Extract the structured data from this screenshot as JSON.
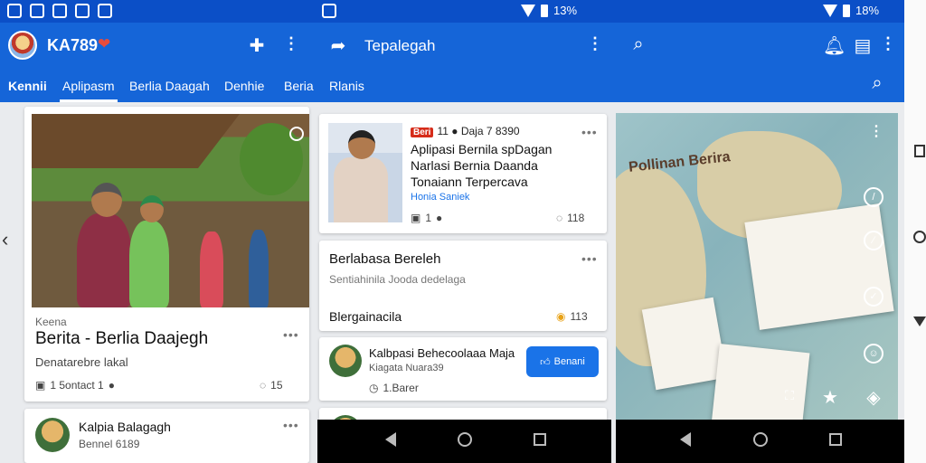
{
  "status_bar": {
    "left_time": "",
    "mid_icon": "ᵒ",
    "mid_text": "",
    "right1_text": "13%",
    "right2_text": "18%"
  },
  "app_bar": {
    "title": "KA789",
    "heart": "❤",
    "second_title": "Tepalegah",
    "logo": "app-logo"
  },
  "tabs": [
    {
      "label": "Kennii"
    },
    {
      "label": "Aplipasm"
    },
    {
      "label": "Berlia Daagah"
    },
    {
      "label": "Denhie"
    },
    {
      "label": "Beria"
    },
    {
      "label": "Rlanis"
    }
  ],
  "feed_card_1": {
    "label": "Keena",
    "title": "Berita - Berlia Daajegh",
    "subtitle": "Denatarebre lakal",
    "meta_left": "1 5ontact 1",
    "meta_right": "15"
  },
  "feed_card_2": {
    "title": "Kalpia Balagagh",
    "subtitle": "Bennel 6189"
  },
  "news_card": {
    "badge": "Beri",
    "header_text": "11 ● Daja 7 8390",
    "line1": "Aplipasi Bernila spDagan",
    "line2": "Narlasi Bernia Daanda",
    "line3": "Tonaiann Terpercava",
    "source": "Honia Saniek",
    "meta_left": "1",
    "meta_right": "118"
  },
  "text_card": {
    "title": "Berlabasa Bereleh",
    "subtitle": "Sentiahinila Jooda dedelaga",
    "footer": "Blergainacila",
    "meta_right": "113"
  },
  "follow_card": {
    "title": "Kalbpasi Behecoolaaa Maja",
    "subtitle": "Kiagata Nuara39",
    "meta": "1.Barer",
    "button_label": "Benani"
  },
  "bottom_peek": {
    "text": "..."
  },
  "map_panel": {
    "title": "Pollinan Berira"
  },
  "icons": {
    "search": "search-icon",
    "share": "share-icon",
    "add": "add-icon",
    "more": "more-vert-icon",
    "like": "thumbs-up-icon",
    "comment": "comment-icon"
  },
  "colors": {
    "primary": "#1565d8",
    "status": "#0b4fc7",
    "button": "#1a73e8",
    "badge": "#d62c1a"
  }
}
